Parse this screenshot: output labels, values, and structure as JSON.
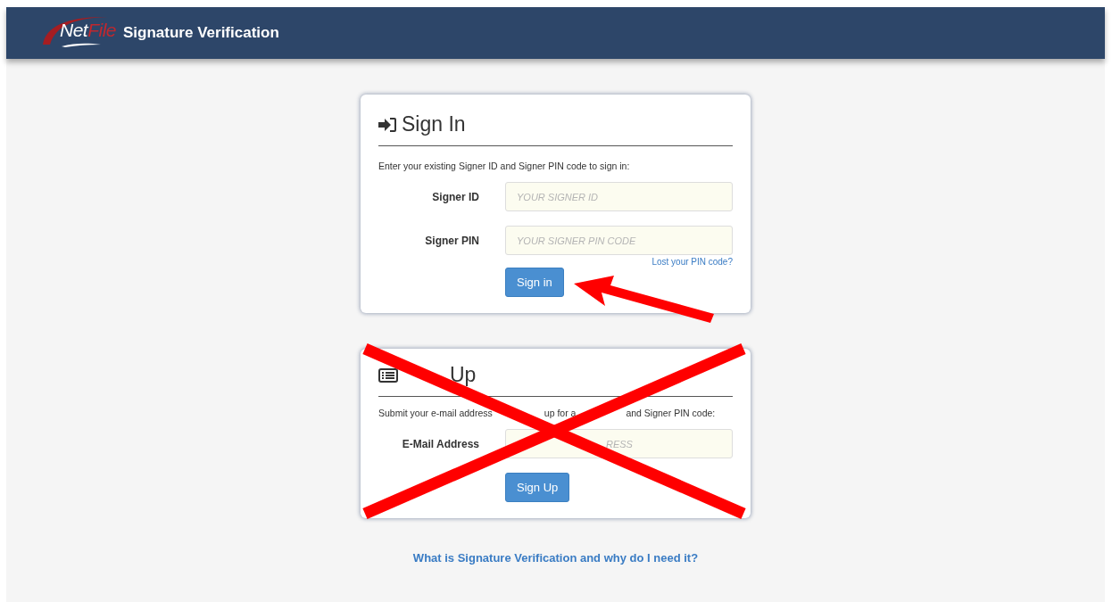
{
  "header": {
    "logo": {
      "first": "Net",
      "second": "File"
    },
    "title": "Signature Verification"
  },
  "sign_in": {
    "title": "Sign In",
    "description": "Enter your existing Signer ID and Signer PIN code to sign in:",
    "fields": [
      {
        "label": "Signer ID",
        "placeholder": "YOUR SIGNER ID"
      },
      {
        "label": "Signer PIN",
        "placeholder": "YOUR SIGNER PIN CODE"
      }
    ],
    "help_link": "Lost your PIN code?",
    "button": "Sign in"
  },
  "sign_up": {
    "title": "Up",
    "description_parts": [
      "Submit your e-mail address",
      "up for a",
      "and Signer PIN code:"
    ],
    "fields": [
      {
        "label": "E-Mail Address",
        "placeholder": "RESS"
      }
    ],
    "button": "Sign Up"
  },
  "footer_link": "What is Signature Verification and why do I need it?"
}
